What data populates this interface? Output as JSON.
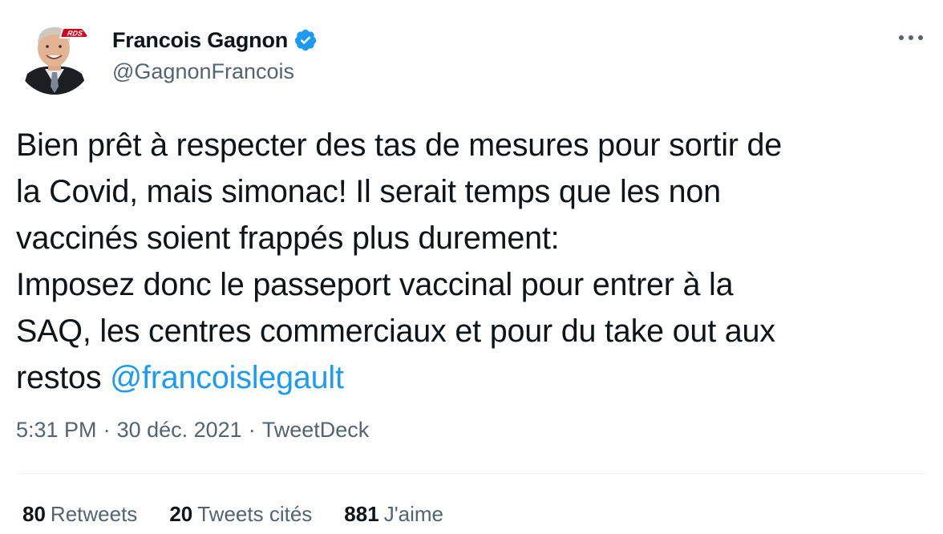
{
  "author": {
    "display_name": "Francois Gagnon",
    "handle": "@GagnonFrancois",
    "verified": true,
    "avatar_logo_text": "RDS"
  },
  "tweet": {
    "lines": [
      "Bien prêt à respecter des tas de mesures pour sortir de",
      "la Covid, mais simonac! Il serait temps que les non",
      "vaccinés soient frappés plus durement:",
      "Imposez donc le passeport vaccinal pour entrer à la",
      "SAQ, les centres commerciaux et pour du take out aux"
    ],
    "last_line_prefix": "restos ",
    "mention": "@francoislegault"
  },
  "meta": {
    "time": "5:31 PM",
    "date": "30 déc. 2021",
    "separator": "·",
    "source": "TweetDeck"
  },
  "stats": {
    "retweets_count": "80",
    "retweets_label": "Retweets",
    "quotes_count": "20",
    "quotes_label": "Tweets cités",
    "likes_count": "881",
    "likes_label": "J'aime"
  },
  "icons": {
    "verified": "verified-badge-icon",
    "more": "more-options-icon"
  },
  "colors": {
    "accent": "#1d9bf0",
    "text": "#0f1419",
    "secondary": "#536471",
    "divider": "#eff3f4"
  }
}
